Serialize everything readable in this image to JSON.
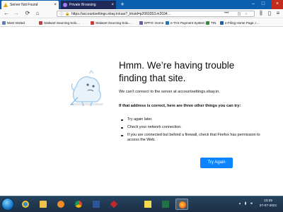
{
  "tabs": [
    {
      "title": "Server Not Found",
      "close": "×"
    },
    {
      "title": "Private Browsing",
      "close": "×"
    }
  ],
  "window_controls": {
    "minimize": "–",
    "maximize": "□",
    "close": "×"
  },
  "new_tab": "+",
  "nav": {
    "back": "←",
    "forward": "→",
    "reload": "⟳",
    "home": "⌂"
  },
  "url": "https://accountsettings.ebay.in/uas?_trksid=p2060353.m2034…",
  "url_dots": "•••",
  "bookmarks": [
    {
      "label": "Most Visited",
      "color": "#5b7fbf"
    },
    {
      "label": "Stalwart Sourcing Solu…",
      "color": "#c63b3b"
    },
    {
      "label": "Stalwart Sourcing Solu…",
      "color": "#c63b3b"
    },
    {
      "label": "EPFO: Home",
      "color": "#6b5aa6"
    },
    {
      "label": "e-TAX Payment System",
      "color": "#2f6fb2"
    },
    {
      "label": "TIN",
      "color": "#3a8a3a"
    },
    {
      "label": "e-Filing Home Page, I…",
      "color": "#1d5fa8"
    }
  ],
  "error_page": {
    "heading": "Hmm. We’re having trouble finding that site.",
    "message": "We can’t connect to the server at accountsettings.ebay.in.",
    "tips_heading": "If that address is correct, here are three other things you can try:",
    "tips": [
      "Try again later.",
      "Check your network connection.",
      "If you are connected but behind a firewall, check that Firefox has permission to access the Web."
    ],
    "try_again_label": "Try Again"
  },
  "taskbar": {
    "time": "13:25",
    "date": "27-07-2021",
    "apps": [
      "ie",
      "explorer",
      "media-player",
      "chrome",
      "word",
      "pdf-reader",
      "sticky-notes",
      "excel",
      "firefox"
    ]
  },
  "colors": {
    "accent": "#0a84ff",
    "tabstrip": "#0b5fae"
  }
}
